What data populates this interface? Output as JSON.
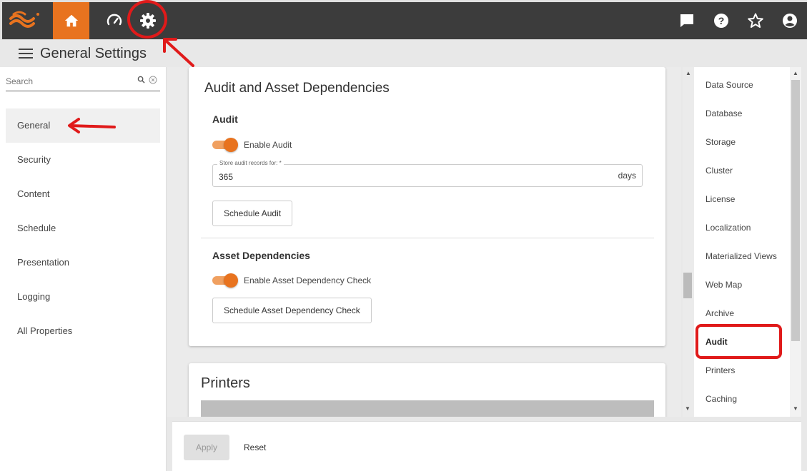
{
  "header": {
    "title": "General Settings"
  },
  "search": {
    "placeholder": "Search"
  },
  "nav": [
    {
      "label": "General",
      "active": true
    },
    {
      "label": "Security"
    },
    {
      "label": "Content"
    },
    {
      "label": "Schedule"
    },
    {
      "label": "Presentation"
    },
    {
      "label": "Logging"
    },
    {
      "label": "All Properties"
    }
  ],
  "audit_card": {
    "title": "Audit and Asset Dependencies",
    "audit_section": "Audit",
    "enable_audit": "Enable Audit",
    "store_label": "Store audit records for: *",
    "store_value": "365",
    "store_unit": "days",
    "schedule_audit": "Schedule Audit",
    "asset_section": "Asset Dependencies",
    "enable_asset": "Enable Asset Dependency Check",
    "schedule_asset": "Schedule Asset Dependency Check"
  },
  "printers_card": {
    "title": "Printers"
  },
  "toc": [
    "Data Source",
    "Database",
    "Storage",
    "Cluster",
    "License",
    "Localization",
    "Materialized Views",
    "Web Map",
    "Archive",
    "Audit",
    "Printers",
    "Caching"
  ],
  "footer": {
    "apply": "Apply",
    "reset": "Reset"
  },
  "colors": {
    "accent": "#e8731f",
    "annotation": "#e01a1a",
    "topbar": "#3c3c3c"
  }
}
